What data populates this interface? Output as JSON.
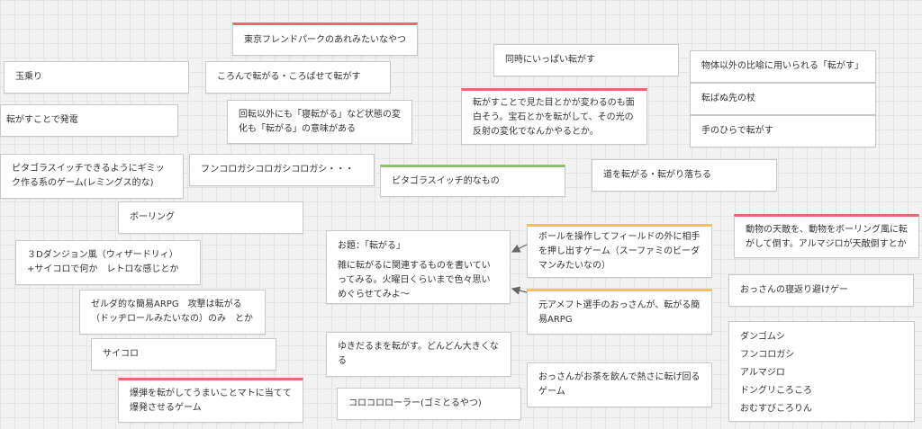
{
  "colors": {
    "red": "#e56872",
    "green": "#8dc26a",
    "yellow": "#f0c25c",
    "arrow": "#666666"
  },
  "notes": {
    "tokyo_friend_park": "東京フレンドパークのあれみたいなやつ",
    "tamanori": "玉乗り",
    "korokoro_korobase": "ころんで転がる・ころばせて転がす",
    "hatsuden": "転がすことで発電",
    "kaiten_igai": "回転以外にも「寝転がる」など状態の変化も「転がる」の意味がある",
    "douji_ippai": "同時にいっぱい転がす",
    "mitame_kawaru": "転がすことで見た目とかが変わるのも面白そう。宝石とかを転がして、その光の反射の変化でなんかやるとか。",
    "buttai_igai": "物体以外の比喩に用いられる「転がす」",
    "korobanu_saki": "転ばぬ先の杖",
    "tenohira": "手のひらで転がす",
    "pitagora_gimmick": "ピタゴラスイッチできるようにギミック作る系のゲーム(レミングス的な)",
    "funkorogashi_long": "フンコロガシコロガシコロガシ・・・",
    "pitagora_teki": "ピタゴラスイッチ的なもの",
    "michi_korogaru": "道を転がる・転がり落ちる",
    "bowling": "ボーリング",
    "dungeon": "３Dダンジョン風（ウィザードリィ）+サイコロで何か　レトロな感じとか",
    "odai_title": "お題：「転がる」",
    "odai_body": "雑に転がるに関連するものを書いていってみる。火曜日くらいまで色々思いめぐらせてみよ〜",
    "ball_field": "ボールを操作してフィールドの外に相手を押し出すゲーム（スーファミのビーダマンみたいなの）",
    "doubutsu_tenteki": "動物の天敵を、動物をボーリング風に転がして倒す。アルマジロが天敵倒すとか",
    "zelda": "ゼルダ的な簡易ARPG　攻撃は転がる（ドッヂロールみたいなの）のみ　とか",
    "ojisan_negaeri": "おっさんの寝返り避けゲー",
    "ameft": "元アメフト選手のおっさんが、転がる簡易ARPG",
    "saikoro": "サイコロ",
    "yukidaruma": "ゆきだるまを転がす。どんどん大きくなる",
    "rolling_list": [
      "ダンゴムシ",
      "フンコロガシ",
      "アルマジロ",
      "ドングリころころ",
      "おむすびころりん"
    ],
    "bakudan": "爆弾を転がしてうまいことマトに当てて爆発させるゲーム",
    "ojisan_ocha": "おっさんがお茶を飲んで熱さに転げ回るゲーム",
    "korokoro_roller": "コロコロローラー(ゴミとるやつ)"
  }
}
